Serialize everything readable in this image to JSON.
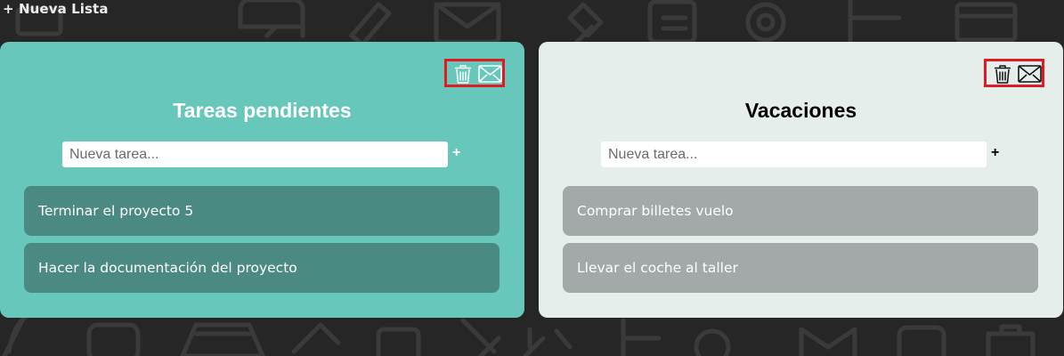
{
  "header": {
    "new_list_label": "+ Nueva Lista"
  },
  "lists": [
    {
      "title": "Tareas pendientes",
      "input_placeholder": "Nueva tarea...",
      "add_label": "+",
      "tasks": [
        {
          "text": "Terminar el proyecto 5"
        },
        {
          "text": "Hacer la documentación del proyecto"
        }
      ],
      "icons": [
        "trash-icon",
        "mail-icon"
      ],
      "colors": {
        "card": "#67c7bb",
        "task": "#4b8a82",
        "title": "#ffffff",
        "highlight": "#e01b22"
      }
    },
    {
      "title": "Vacaciones",
      "input_placeholder": "Nueva tarea...",
      "add_label": "+",
      "tasks": [
        {
          "text": "Comprar billetes vuelo"
        },
        {
          "text": "Llevar el coche al taller"
        }
      ],
      "icons": [
        "trash-icon",
        "mail-icon"
      ],
      "colors": {
        "card": "#e6eeec",
        "task": "#a3a9a8",
        "title": "#000000",
        "highlight": "#e01b22"
      }
    }
  ],
  "page": {
    "background": "#262626"
  }
}
